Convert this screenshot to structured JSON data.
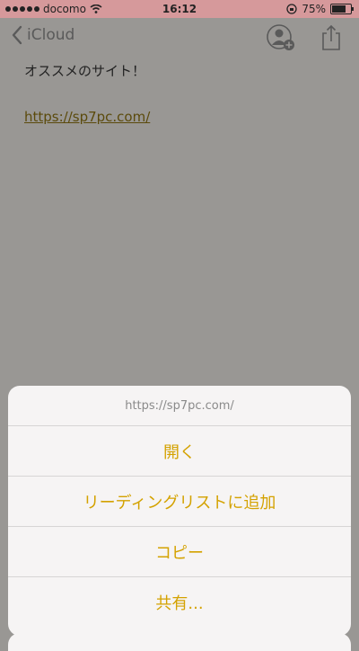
{
  "status_bar": {
    "carrier": "docomo",
    "time": "16:12",
    "battery": "75%",
    "battery_level": 0.75
  },
  "nav": {
    "back_label": "iCloud"
  },
  "note": {
    "line1": "オススメのサイト！",
    "link": "https://sp7pc.com/"
  },
  "action_sheet": {
    "title": "https://sp7pc.com/",
    "items": [
      {
        "label": "開く"
      },
      {
        "label": "リーディングリストに追加"
      },
      {
        "label": "コピー"
      },
      {
        "label": "共有..."
      }
    ],
    "accent_color": "#d4a200"
  }
}
